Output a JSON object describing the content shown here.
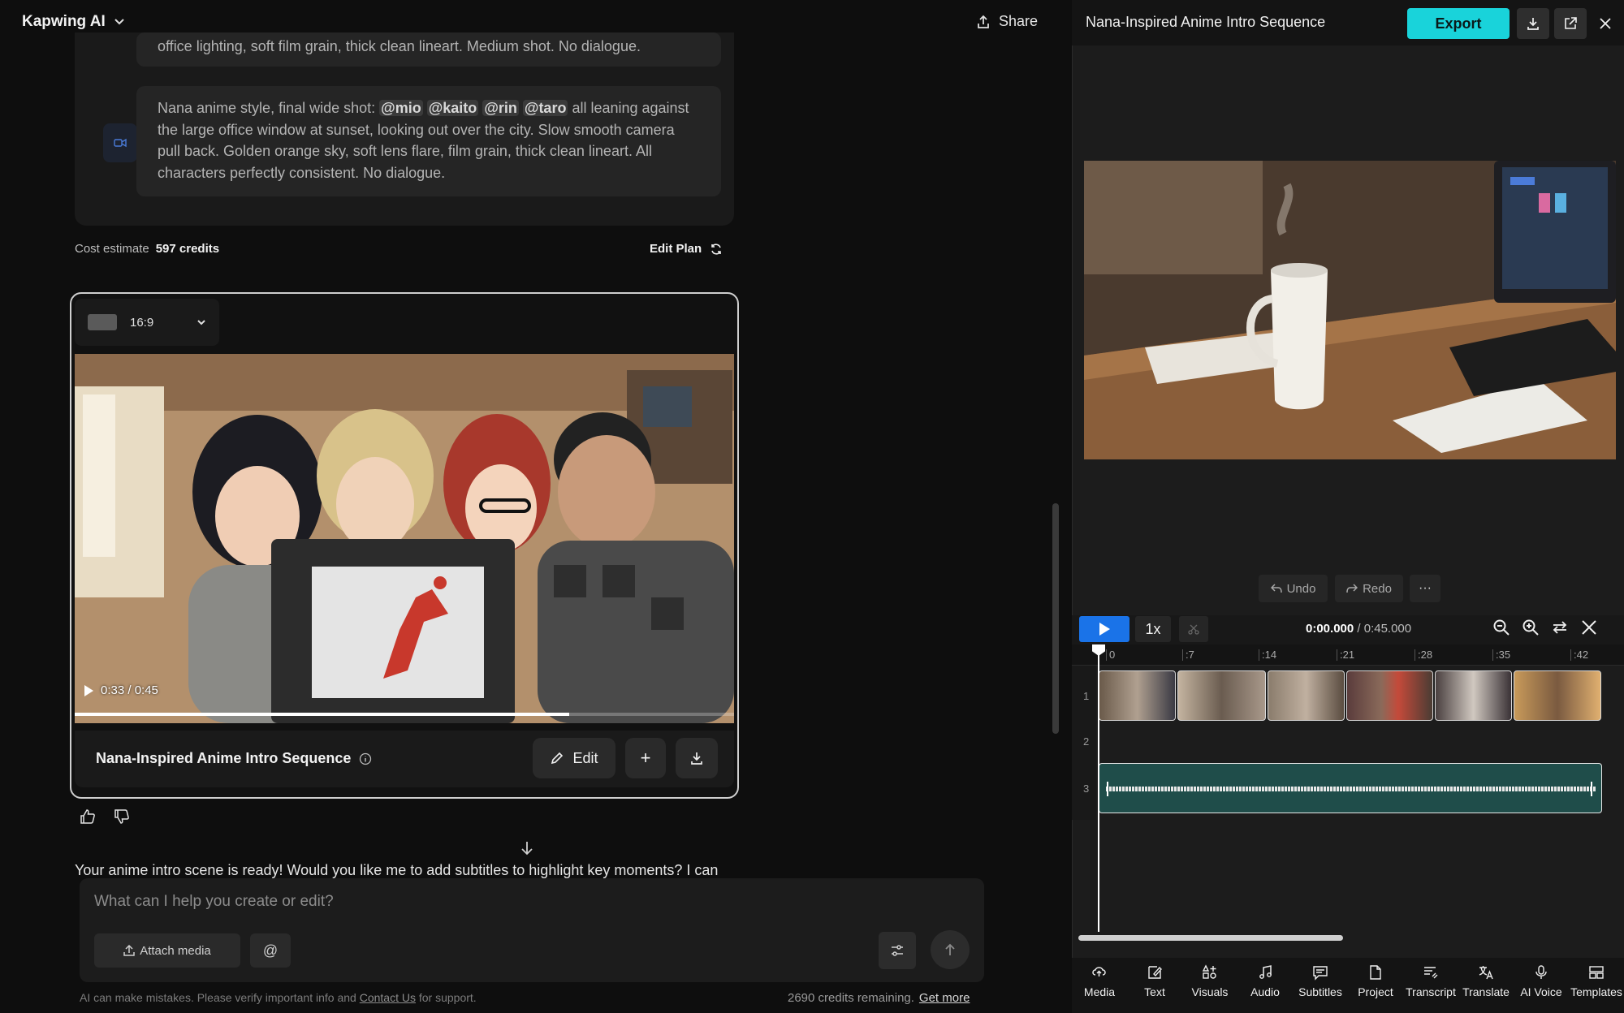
{
  "app": {
    "name": "Kapwing AI",
    "share_label": "Share"
  },
  "chat": {
    "prompt_top_fragment": "office lighting, soft film grain, thick clean lineart. Medium shot. No dialogue.",
    "prompt_final": {
      "prefix": "Nana anime style, final wide shot: ",
      "mentions": [
        "@mio",
        "@kaito",
        "@rin",
        "@taro"
      ],
      "suffix": " all leaning against the large office window at sunset, looking out over the city. Slow smooth camera pull back. Golden orange sky, soft lens flare, film grain, thick clean lineart. All characters perfectly consistent. No dialogue."
    },
    "cost_label": "Cost estimate",
    "cost_value": "597 credits",
    "edit_plan_label": "Edit Plan",
    "aspect_ratio": "16:9",
    "video_time": "0:33 / 0:45",
    "video_progress": 0.75,
    "video_title": "Nana-Inspired Anime Intro Sequence",
    "edit_label": "Edit",
    "plus_label": "+",
    "message": "Your anime intro scene is ready! Would you like me to add subtitles to highlight key moments? I can",
    "input_placeholder": "What can I help you create or edit?",
    "attach_label": "Attach media",
    "mention_label": "@",
    "disclaimer_prefix": "AI can make mistakes. Please verify important info and ",
    "contact_label": "Contact Us",
    "disclaimer_suffix": " for support.",
    "credits_remaining": "2690 credits remaining.",
    "get_more_label": "Get more"
  },
  "editor": {
    "project_title": "Nana-Inspired Anime Intro Sequence",
    "export_label": "Export",
    "undo_label": "Undo",
    "redo_label": "Redo",
    "more_label": "···",
    "speed_label": "1x",
    "current_time": "0:00.000",
    "total_time": " / 0:45.000",
    "ruler_ticks": [
      "0",
      ":7",
      ":14",
      ":21",
      ":28",
      ":35",
      ":42"
    ],
    "track_numbers": [
      "1",
      "2",
      "3"
    ],
    "toolbar": [
      {
        "label": "Media",
        "icon": "upload-cloud-icon"
      },
      {
        "label": "Text",
        "icon": "text-edit-icon"
      },
      {
        "label": "Visuals",
        "icon": "shapes-icon"
      },
      {
        "label": "Audio",
        "icon": "music-note-icon"
      },
      {
        "label": "Subtitles",
        "icon": "subtitles-icon"
      },
      {
        "label": "Project",
        "icon": "document-icon"
      },
      {
        "label": "Transcript",
        "icon": "transcript-icon"
      },
      {
        "label": "Translate",
        "icon": "translate-icon"
      },
      {
        "label": "AI Voice",
        "icon": "microphone-icon"
      },
      {
        "label": "Templates",
        "icon": "templates-icon"
      }
    ]
  },
  "colors": {
    "accent": "#19d3da",
    "play": "#1a73e8",
    "audio_track": "#1f4d4a"
  }
}
